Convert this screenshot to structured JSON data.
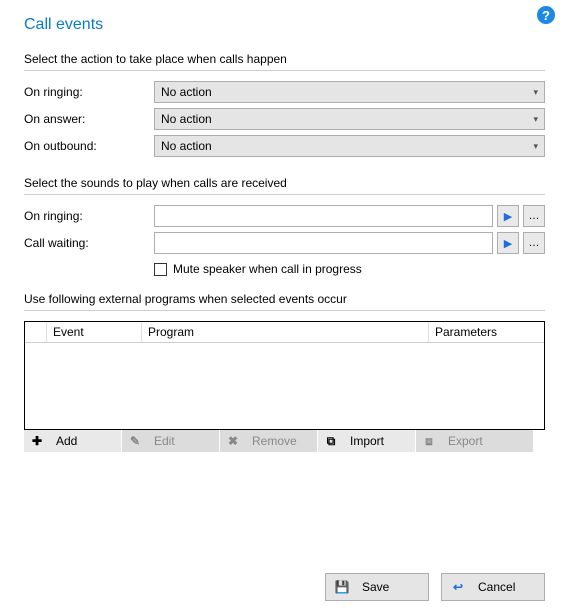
{
  "title": "Call events",
  "help_tooltip": "?",
  "sections": {
    "actions": {
      "label": "Select the action to take place when calls happen",
      "rows": {
        "on_ringing": {
          "label": "On ringing:",
          "value": "No action"
        },
        "on_answer": {
          "label": "On answer:",
          "value": "No action"
        },
        "on_outbound": {
          "label": "On outbound:",
          "value": "No action"
        }
      }
    },
    "sounds": {
      "label": "Select the sounds to play when calls are received",
      "rows": {
        "on_ringing": {
          "label": "On ringing:",
          "value": ""
        },
        "call_waiting": {
          "label": "Call waiting:",
          "value": ""
        }
      },
      "mute": {
        "label": "Mute speaker when call in progress",
        "checked": false
      }
    },
    "programs": {
      "label": "Use following external programs when selected events occur",
      "columns": {
        "event": "Event",
        "program": "Program",
        "parameters": "Parameters"
      },
      "rows": []
    }
  },
  "toolbar": {
    "add": {
      "label": "Add",
      "enabled": true
    },
    "edit": {
      "label": "Edit",
      "enabled": false
    },
    "remove": {
      "label": "Remove",
      "enabled": false
    },
    "import": {
      "label": "Import",
      "enabled": true
    },
    "export": {
      "label": "Export",
      "enabled": false
    }
  },
  "footer": {
    "save": "Save",
    "cancel": "Cancel"
  }
}
